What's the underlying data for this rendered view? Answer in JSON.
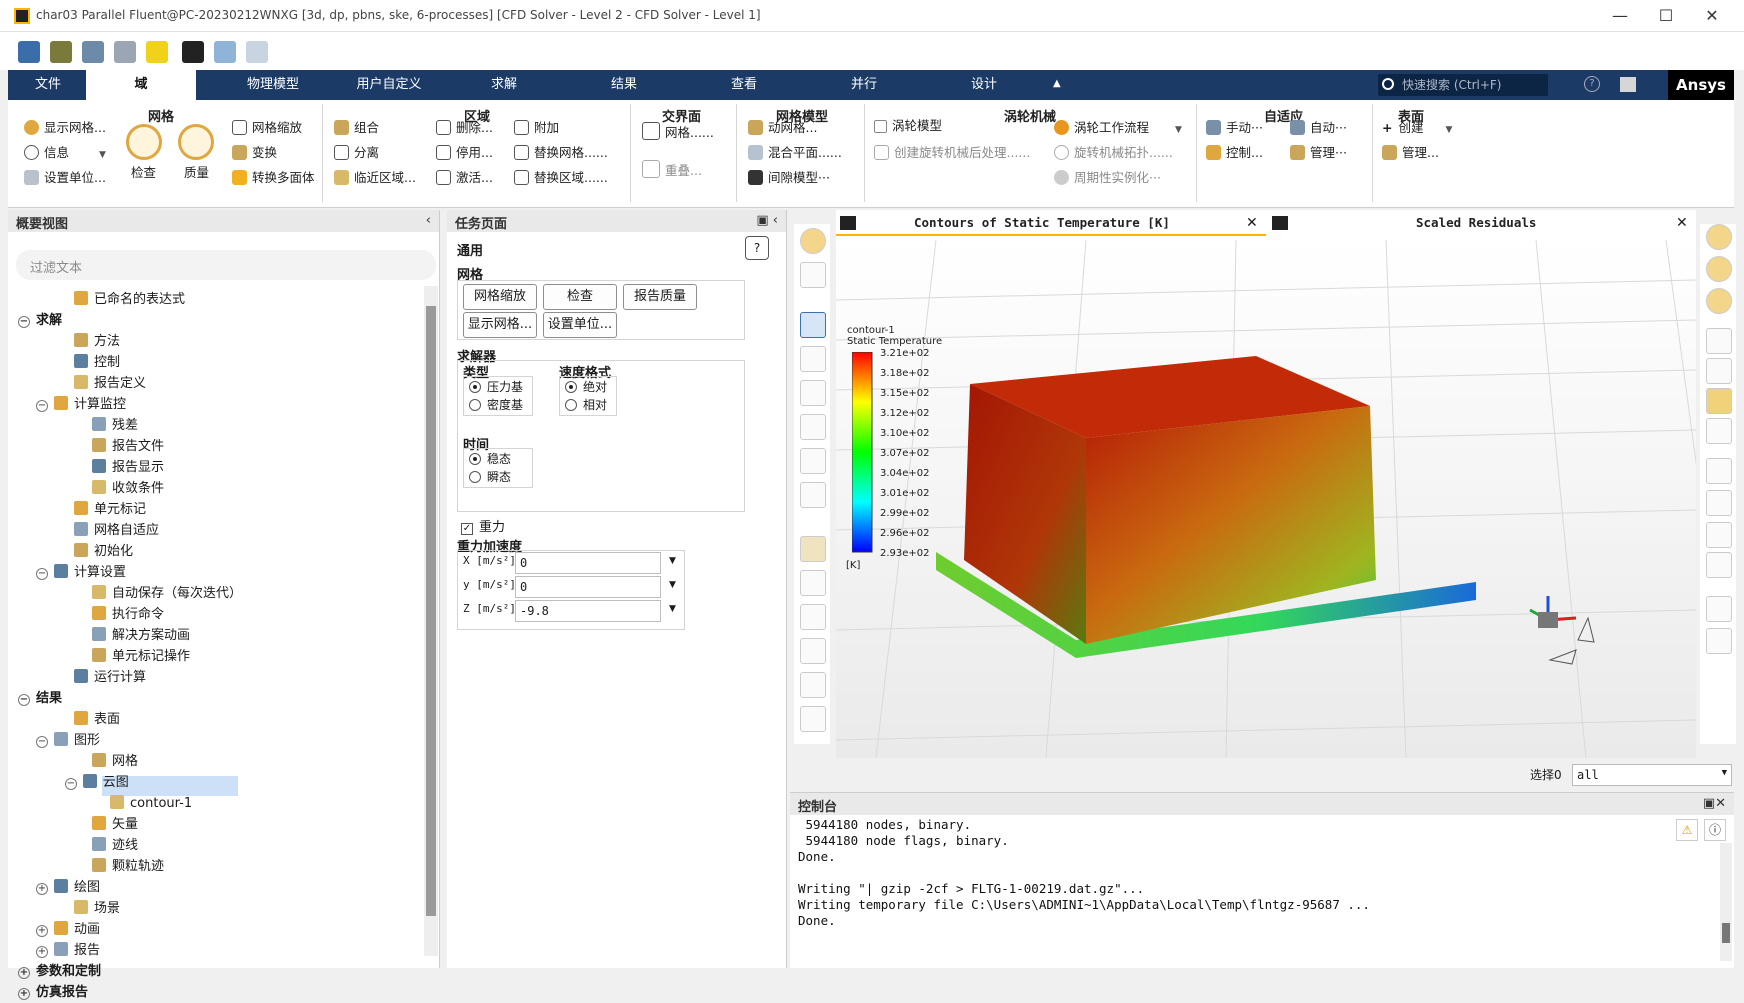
{
  "window": {
    "title": "char03 Parallel Fluent@PC-20230212WNXG  [3d, dp, pbns, ske, 6-processes] [CFD Solver - Level 2 - CFD Solver - Level 1]",
    "minimize": "—",
    "maximize": "☐",
    "close": "✕"
  },
  "ribbon_tabs": [
    "文件",
    "域",
    "物理模型",
    "用户自定义",
    "求解",
    "结果",
    "查看",
    "并行",
    "设计"
  ],
  "active_tab": "域",
  "search_placeholder": "快速搜索 (Ctrl+F)",
  "brand": "Ansys",
  "ribbon": {
    "mesh": {
      "title": "网格",
      "show_mesh": "显示网格...",
      "info": "信息",
      "set_units": "设置单位...",
      "check": "检查",
      "quality": "质量",
      "scale": "网格缩放",
      "transform": "变换",
      "convert_poly": "转换多面体"
    },
    "zone": {
      "title": "区域",
      "combine": "组合",
      "separate": "分离",
      "adjacency": "临近区域...",
      "delete": "删除...",
      "deactivate": "停用...",
      "activate": "激活...",
      "append": "附加",
      "replace_mesh": "替换网格......",
      "replace_zone": "替换区域......"
    },
    "interface": {
      "title": "交界面",
      "mesh": "网格......",
      "overset": "重叠..."
    },
    "mesh_models": {
      "title": "网格模型",
      "dynamic": "动网格...",
      "mixing_plane": "混合平面......",
      "gap": "间隙模型···"
    },
    "turbo": {
      "title": "涡轮机械",
      "turbo_model": "涡轮模型",
      "create_post": "创建旋转机械后处理......",
      "workflow": "涡轮工作流程",
      "topology": "旋转机械拓扑......",
      "periodic": "周期性实例化···"
    },
    "adapt": {
      "title": "自适应",
      "manual": "手动···",
      "automatic": "自动···",
      "controls": "控制...",
      "manage": "管理···"
    },
    "surface": {
      "title": "表面",
      "create": "创建",
      "manage": "管理..."
    }
  },
  "outline": {
    "title": "概要视图",
    "filter_placeholder": "过滤文本",
    "items": [
      {
        "label": "已命名的表达式",
        "level": 2,
        "bold": false,
        "icon": "fx-icon",
        "expander": ""
      },
      {
        "label": "求解",
        "level": 0,
        "bold": true,
        "icon": "",
        "expander": "−"
      },
      {
        "label": "方法",
        "level": 2,
        "bold": false,
        "icon": "methods-icon",
        "expander": ""
      },
      {
        "label": "控制",
        "level": 2,
        "bold": false,
        "icon": "controls-icon",
        "expander": ""
      },
      {
        "label": "报告定义",
        "level": 2,
        "bold": false,
        "icon": "report-definition-icon",
        "expander": ""
      },
      {
        "label": "计算监控",
        "level": 1,
        "bold": false,
        "icon": "monitor-icon",
        "expander": "−"
      },
      {
        "label": "残差",
        "level": 3,
        "bold": false,
        "icon": "residuals-icon",
        "expander": ""
      },
      {
        "label": "报告文件",
        "level": 3,
        "bold": false,
        "icon": "report-file-icon",
        "expander": ""
      },
      {
        "label": "报告显示",
        "level": 3,
        "bold": false,
        "icon": "report-plot-icon",
        "expander": ""
      },
      {
        "label": "收敛条件",
        "level": 3,
        "bold": false,
        "icon": "convergence-icon",
        "expander": ""
      },
      {
        "label": "单元标记",
        "level": 2,
        "bold": false,
        "icon": "cell-register-icon",
        "expander": ""
      },
      {
        "label": "网格自适应",
        "level": 2,
        "bold": false,
        "icon": "mesh-adaption-icon",
        "expander": ""
      },
      {
        "label": "初始化",
        "level": 2,
        "bold": false,
        "icon": "initialization-icon",
        "expander": ""
      },
      {
        "label": "计算设置",
        "level": 1,
        "bold": false,
        "icon": "gear-icon",
        "expander": "−"
      },
      {
        "label": "自动保存（每次迭代）",
        "level": 3,
        "bold": false,
        "icon": "autosave-icon",
        "expander": ""
      },
      {
        "label": "执行命令",
        "level": 3,
        "bold": false,
        "icon": "execute-command-icon",
        "expander": ""
      },
      {
        "label": "解决方案动画",
        "level": 3,
        "bold": false,
        "icon": "animation-icon",
        "expander": ""
      },
      {
        "label": "单元标记操作",
        "level": 3,
        "bold": false,
        "icon": "cell-register-op-icon",
        "expander": ""
      },
      {
        "label": "运行计算",
        "level": 2,
        "bold": false,
        "icon": "run-calculation-icon",
        "expander": ""
      },
      {
        "label": "结果",
        "level": 0,
        "bold": true,
        "icon": "",
        "expander": "−"
      },
      {
        "label": "表面",
        "level": 2,
        "bold": false,
        "icon": "surface-icon",
        "expander": ""
      },
      {
        "label": "图形",
        "level": 1,
        "bold": false,
        "icon": "graphics-icon",
        "expander": "−"
      },
      {
        "label": "网格",
        "level": 3,
        "bold": false,
        "icon": "mesh-icon",
        "expander": ""
      },
      {
        "label": "云图",
        "level": 2.6,
        "bold": false,
        "icon": "contour-icon",
        "expander": "−"
      },
      {
        "label": "contour-1",
        "level": 4,
        "bold": false,
        "icon": "contour-item-icon",
        "expander": ""
      },
      {
        "label": "矢量",
        "level": 3,
        "bold": false,
        "icon": "vector-icon",
        "expander": ""
      },
      {
        "label": "迹线",
        "level": 3,
        "bold": false,
        "icon": "pathline-icon",
        "expander": ""
      },
      {
        "label": "颗粒轨迹",
        "level": 3,
        "bold": false,
        "icon": "particle-track-icon",
        "expander": ""
      },
      {
        "label": "绘图",
        "level": 1,
        "bold": false,
        "icon": "plot-icon",
        "expander": "+"
      },
      {
        "label": "场景",
        "level": 2,
        "bold": false,
        "icon": "scene-icon",
        "expander": ""
      },
      {
        "label": "动画",
        "level": 1,
        "bold": false,
        "icon": "animation-folder-icon",
        "expander": "+"
      },
      {
        "label": "报告",
        "level": 1,
        "bold": false,
        "icon": "reports-icon",
        "expander": "+"
      },
      {
        "label": "参数和定制",
        "level": 0,
        "bold": true,
        "icon": "",
        "expander": "+"
      },
      {
        "label": "仿真报告",
        "level": 0,
        "bold": true,
        "icon": "",
        "expander": "+"
      }
    ],
    "selected": "contour-1"
  },
  "task": {
    "title": "任务页面",
    "section": "通用",
    "mesh_label": "网格",
    "btn_scale": "网格缩放",
    "btn_check": "检查",
    "btn_report_quality": "报告质量",
    "btn_display": "显示网格...",
    "btn_units": "设置单位...",
    "solver_label": "求解器",
    "type_label": "类型",
    "type_pressure": "压力基",
    "type_density": "密度基",
    "velocity_label": "速度格式",
    "vel_absolute": "绝对",
    "vel_relative": "相对",
    "time_label": "时间",
    "time_steady": "稳态",
    "time_transient": "瞬态",
    "gravity": "重力",
    "gravity_accel": "重力加速度",
    "gx_label": "X [m/s²]",
    "gx": "0",
    "gy_label": "y [m/s²]",
    "gy": "0",
    "gz_label": "Z [m/s²]",
    "gz": "-9.8"
  },
  "graphics": {
    "tab1": "Contours of Static Temperature [K]",
    "tab2": "Scaled Residuals",
    "legend_name": "contour-1",
    "legend_var": "Static Temperature",
    "legend_unit": "[K]",
    "legend_ticks": [
      "3.21e+02",
      "3.18e+02",
      "3.15e+02",
      "3.12e+02",
      "3.10e+02",
      "3.07e+02",
      "3.04e+02",
      "3.01e+02",
      "2.99e+02",
      "2.96e+02",
      "2.93e+02"
    ],
    "select_label": "选择0",
    "select_value": "all"
  },
  "console": {
    "title": "控制台",
    "text": " 5944180 nodes, binary.\n 5944180 node flags, binary.\nDone.\n\nWriting \"| gzip -2cf > FLTG-1-00219.dat.gz\"...\nWriting temporary file C:\\Users\\ADMINI~1\\AppData\\Local\\Temp\\flntgz-95687 ...\nDone."
  },
  "colors": {
    "tab_bar": "#1b3a66",
    "accent": "#ffb400",
    "selected": "#cce1f7"
  }
}
